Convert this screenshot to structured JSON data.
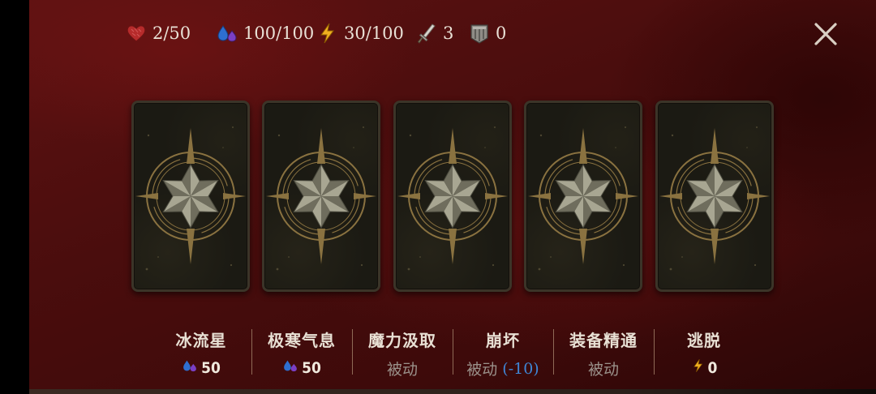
{
  "hud": {
    "health": "2/50",
    "mana": "100/100",
    "energy": "30/100",
    "attack": "3",
    "armor": "0"
  },
  "icons": {
    "health": "heart-icon",
    "mana": "mana-drops-icon",
    "energy": "lightning-icon",
    "attack": "sword-icon",
    "armor": "shield-icon",
    "close": "close-icon",
    "card_back": "compass-star-icon"
  },
  "colors": {
    "background": "#4a0d0d",
    "card_back": "#1b1a13",
    "card_border": "#3b3428",
    "star": "#8c8a78",
    "gold": "#8a7240",
    "passive_text": "#9a918a",
    "reduction_text": "#3f86d6",
    "health_icon": "#c03030",
    "mana_icon": "#2e6fd0",
    "energy_icon": "#f0b020"
  },
  "cards": [
    {
      "id": "card-1"
    },
    {
      "id": "card-2"
    },
    {
      "id": "card-3"
    },
    {
      "id": "card-4"
    },
    {
      "id": "card-5"
    }
  ],
  "skills": [
    {
      "name": "冰流星",
      "cost_type": "mana",
      "cost": "50"
    },
    {
      "name": "极寒气息",
      "cost_type": "mana",
      "cost": "50"
    },
    {
      "name": "魔力汲取",
      "cost_type": "passive",
      "cost": "被动"
    },
    {
      "name": "崩坏",
      "cost_type": "passive",
      "cost": "被动",
      "note": "(-10)"
    },
    {
      "name": "装备精通",
      "cost_type": "passive",
      "cost": "被动"
    },
    {
      "name": "逃脱",
      "cost_type": "energy",
      "cost": "0"
    }
  ]
}
